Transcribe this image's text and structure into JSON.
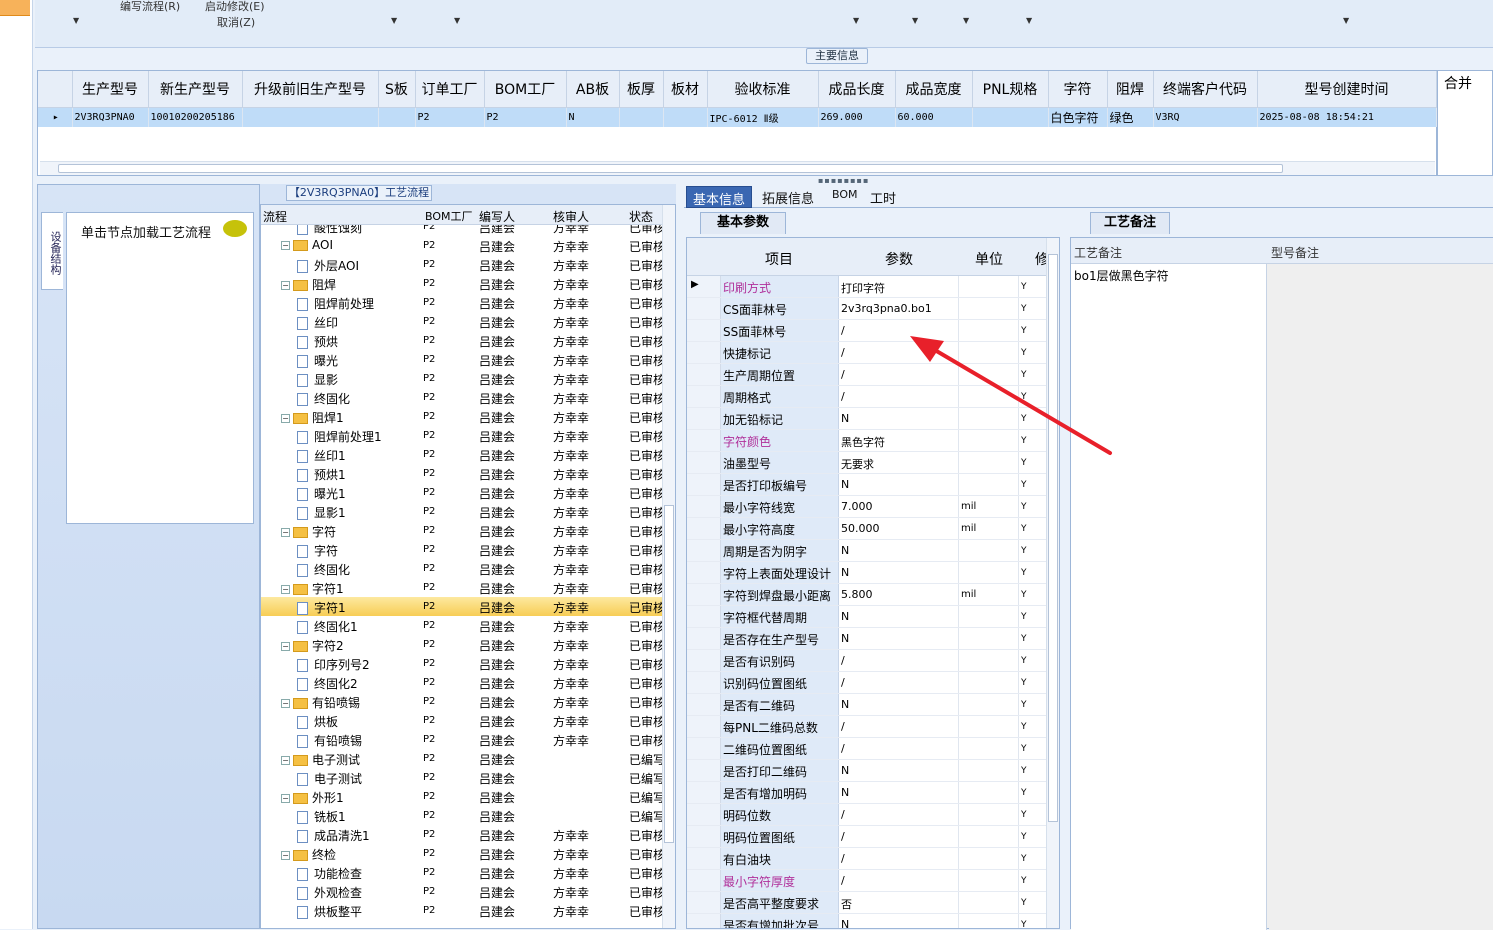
{
  "toolbar": {
    "items": [
      "编写流程(R)",
      "启动修改(E)",
      "取消(Z)"
    ]
  },
  "main_info": {
    "legend": "主要信息",
    "columns": [
      "生产型号",
      "新生产型号",
      "升级前旧生产型号",
      "S板",
      "订单工厂",
      "BOM工厂",
      "AB板",
      "板厚",
      "板材",
      "验收标准",
      "成品长度",
      "成品宽度",
      "PNL规格",
      "字符",
      "阻焊",
      "终端客户代码",
      "型号创建时间"
    ],
    "row": [
      "2V3RQ3PNA0",
      "10010200205186",
      "",
      "",
      "P2",
      "P2",
      "N",
      "",
      "",
      "IPC-6012 Ⅱ级",
      "269.000",
      "60.000",
      "",
      "白色字符",
      "绿色",
      "V3RQ",
      "2025-08-08 18:54:21"
    ],
    "right_col": "合并"
  },
  "left_panel": {
    "vtab": "设备结构",
    "load_text": "单击节点加载工艺流程"
  },
  "process": {
    "legend": "【2V3RQ3PNA0】工艺流程",
    "columns": [
      "流程",
      "BOM工厂",
      "编写人",
      "核审人",
      "状态"
    ],
    "rows": [
      {
        "name": "酸性蚀刻",
        "kind": "doc",
        "bom": "P2",
        "writer": "吕建会",
        "auditor": "方幸幸",
        "status": "已审核"
      },
      {
        "name": "AOI",
        "kind": "folder",
        "bom": "P2",
        "writer": "吕建会",
        "auditor": "方幸幸",
        "status": "已审核"
      },
      {
        "name": "外层AOI",
        "kind": "doc",
        "bom": "P2",
        "writer": "吕建会",
        "auditor": "方幸幸",
        "status": "已审核"
      },
      {
        "name": "阻焊",
        "kind": "folder",
        "bom": "P2",
        "writer": "吕建会",
        "auditor": "方幸幸",
        "status": "已审核"
      },
      {
        "name": "阻焊前处理",
        "kind": "doc",
        "bom": "P2",
        "writer": "吕建会",
        "auditor": "方幸幸",
        "status": "已审核"
      },
      {
        "name": "丝印",
        "kind": "doc",
        "bom": "P2",
        "writer": "吕建会",
        "auditor": "方幸幸",
        "status": "已审核"
      },
      {
        "name": "预烘",
        "kind": "doc",
        "bom": "P2",
        "writer": "吕建会",
        "auditor": "方幸幸",
        "status": "已审核"
      },
      {
        "name": "曝光",
        "kind": "doc",
        "bom": "P2",
        "writer": "吕建会",
        "auditor": "方幸幸",
        "status": "已审核"
      },
      {
        "name": "显影",
        "kind": "doc",
        "bom": "P2",
        "writer": "吕建会",
        "auditor": "方幸幸",
        "status": "已审核"
      },
      {
        "name": "终固化",
        "kind": "doc",
        "bom": "P2",
        "writer": "吕建会",
        "auditor": "方幸幸",
        "status": "已审核"
      },
      {
        "name": "阻焊1",
        "kind": "folder",
        "bom": "P2",
        "writer": "吕建会",
        "auditor": "方幸幸",
        "status": "已审核"
      },
      {
        "name": "阻焊前处理1",
        "kind": "doc",
        "bom": "P2",
        "writer": "吕建会",
        "auditor": "方幸幸",
        "status": "已审核"
      },
      {
        "name": "丝印1",
        "kind": "doc",
        "bom": "P2",
        "writer": "吕建会",
        "auditor": "方幸幸",
        "status": "已审核"
      },
      {
        "name": "预烘1",
        "kind": "doc",
        "bom": "P2",
        "writer": "吕建会",
        "auditor": "方幸幸",
        "status": "已审核"
      },
      {
        "name": "曝光1",
        "kind": "doc",
        "bom": "P2",
        "writer": "吕建会",
        "auditor": "方幸幸",
        "status": "已审核"
      },
      {
        "name": "显影1",
        "kind": "doc",
        "bom": "P2",
        "writer": "吕建会",
        "auditor": "方幸幸",
        "status": "已审核"
      },
      {
        "name": "字符",
        "kind": "folder",
        "bom": "P2",
        "writer": "吕建会",
        "auditor": "方幸幸",
        "status": "已审核"
      },
      {
        "name": "字符",
        "kind": "doc",
        "bom": "P2",
        "writer": "吕建会",
        "auditor": "方幸幸",
        "status": "已审核"
      },
      {
        "name": "终固化",
        "kind": "doc",
        "bom": "P2",
        "writer": "吕建会",
        "auditor": "方幸幸",
        "status": "已审核"
      },
      {
        "name": "字符1",
        "kind": "folder",
        "bom": "P2",
        "writer": "吕建会",
        "auditor": "方幸幸",
        "status": "已审核"
      },
      {
        "name": "字符1",
        "kind": "doc",
        "bom": "P2",
        "writer": "吕建会",
        "auditor": "方幸幸",
        "status": "已审核",
        "selected": true
      },
      {
        "name": "终固化1",
        "kind": "doc",
        "bom": "P2",
        "writer": "吕建会",
        "auditor": "方幸幸",
        "status": "已审核"
      },
      {
        "name": "字符2",
        "kind": "folder",
        "bom": "P2",
        "writer": "吕建会",
        "auditor": "方幸幸",
        "status": "已审核"
      },
      {
        "name": "印序列号2",
        "kind": "doc",
        "bom": "P2",
        "writer": "吕建会",
        "auditor": "方幸幸",
        "status": "已审核"
      },
      {
        "name": "终固化2",
        "kind": "doc",
        "bom": "P2",
        "writer": "吕建会",
        "auditor": "方幸幸",
        "status": "已审核"
      },
      {
        "name": "有铅喷锡",
        "kind": "folder",
        "bom": "P2",
        "writer": "吕建会",
        "auditor": "方幸幸",
        "status": "已审核"
      },
      {
        "name": "烘板",
        "kind": "doc",
        "bom": "P2",
        "writer": "吕建会",
        "auditor": "方幸幸",
        "status": "已审核"
      },
      {
        "name": "有铅喷锡",
        "kind": "doc",
        "bom": "P2",
        "writer": "吕建会",
        "auditor": "方幸幸",
        "status": "已审核"
      },
      {
        "name": "电子测试",
        "kind": "folder",
        "bom": "P2",
        "writer": "吕建会",
        "auditor": "",
        "status": "已编写"
      },
      {
        "name": "电子测试",
        "kind": "doc",
        "bom": "P2",
        "writer": "吕建会",
        "auditor": "",
        "status": "已编写"
      },
      {
        "name": "外形1",
        "kind": "folder",
        "bom": "P2",
        "writer": "吕建会",
        "auditor": "",
        "status": "已编写"
      },
      {
        "name": "铣板1",
        "kind": "doc",
        "bom": "P2",
        "writer": "吕建会",
        "auditor": "",
        "status": "已编写"
      },
      {
        "name": "成品清洗1",
        "kind": "doc",
        "bom": "P2",
        "writer": "吕建会",
        "auditor": "方幸幸",
        "status": "已审核"
      },
      {
        "name": "终检",
        "kind": "folder",
        "bom": "P2",
        "writer": "吕建会",
        "auditor": "方幸幸",
        "status": "已审核"
      },
      {
        "name": "功能检查",
        "kind": "doc",
        "bom": "P2",
        "writer": "吕建会",
        "auditor": "方幸幸",
        "status": "已审核"
      },
      {
        "name": "外观检查",
        "kind": "doc",
        "bom": "P2",
        "writer": "吕建会",
        "auditor": "方幸幸",
        "status": "已审核"
      },
      {
        "name": "烘板整平",
        "kind": "doc",
        "bom": "P2",
        "writer": "吕建会",
        "auditor": "方幸幸",
        "status": "已审核"
      }
    ]
  },
  "tabs": [
    "基本信息",
    "拓展信息",
    "BOM",
    "工时"
  ],
  "basic": {
    "subtab": "基本参数",
    "columns": [
      "项目",
      "参数",
      "单位",
      "修"
    ],
    "rows": [
      {
        "item": "印刷方式",
        "param": "打印字符",
        "unit": "",
        "mod": "Y",
        "pink": true,
        "current": true
      },
      {
        "item": "CS面菲林号",
        "param": "2v3rq3pna0.bo1",
        "unit": "",
        "mod": "Y"
      },
      {
        "item": "SS面菲林号",
        "param": "/",
        "unit": "",
        "mod": "Y"
      },
      {
        "item": "快捷标记",
        "param": "/",
        "unit": "",
        "mod": "Y"
      },
      {
        "item": "生产周期位置",
        "param": "/",
        "unit": "",
        "mod": "Y"
      },
      {
        "item": "周期格式",
        "param": "/",
        "unit": "",
        "mod": "Y"
      },
      {
        "item": "加无铅标记",
        "param": "N",
        "unit": "",
        "mod": "Y"
      },
      {
        "item": "字符颜色",
        "param": "黑色字符",
        "unit": "",
        "mod": "Y",
        "pink": true
      },
      {
        "item": "油墨型号",
        "param": "无要求",
        "unit": "",
        "mod": "Y"
      },
      {
        "item": "是否打印板编号",
        "param": "N",
        "unit": "",
        "mod": "Y"
      },
      {
        "item": "最小字符线宽",
        "param": "7.000",
        "unit": "mil",
        "mod": "Y"
      },
      {
        "item": "最小字符高度",
        "param": "50.000",
        "unit": "mil",
        "mod": "Y"
      },
      {
        "item": "周期是否为阴字",
        "param": "N",
        "unit": "",
        "mod": "Y"
      },
      {
        "item": "字符上表面处理设计",
        "param": "N",
        "unit": "",
        "mod": "Y"
      },
      {
        "item": "字符到焊盘最小距离",
        "param": "5.800",
        "unit": "mil",
        "mod": "Y"
      },
      {
        "item": "字符框代替周期",
        "param": "N",
        "unit": "",
        "mod": "Y"
      },
      {
        "item": "是否存在生产型号",
        "param": "N",
        "unit": "",
        "mod": "Y"
      },
      {
        "item": "是否有识别码",
        "param": "/",
        "unit": "",
        "mod": "Y"
      },
      {
        "item": "识别码位置图纸",
        "param": "/",
        "unit": "",
        "mod": "Y"
      },
      {
        "item": "是否有二维码",
        "param": "N",
        "unit": "",
        "mod": "Y"
      },
      {
        "item": "每PNL二维码总数",
        "param": "/",
        "unit": "",
        "mod": "Y"
      },
      {
        "item": "二维码位置图纸",
        "param": "/",
        "unit": "",
        "mod": "Y"
      },
      {
        "item": "是否打印二维码",
        "param": "N",
        "unit": "",
        "mod": "Y"
      },
      {
        "item": "是否有增加明码",
        "param": "N",
        "unit": "",
        "mod": "Y"
      },
      {
        "item": "明码位数",
        "param": "/",
        "unit": "",
        "mod": "Y"
      },
      {
        "item": "明码位置图纸",
        "param": "/",
        "unit": "",
        "mod": "Y"
      },
      {
        "item": "有白油块",
        "param": "/",
        "unit": "",
        "mod": "Y"
      },
      {
        "item": "最小字符厚度",
        "param": "/",
        "unit": "",
        "mod": "Y",
        "pink": true
      },
      {
        "item": "是否高平整度要求",
        "param": "否",
        "unit": "",
        "mod": "Y"
      },
      {
        "item": "是否有增加批次号",
        "param": "N",
        "unit": "",
        "mod": "Y"
      }
    ]
  },
  "notes": {
    "subtab": "工艺备注",
    "col1": "工艺备注",
    "col2": "型号备注",
    "text": "bo1层做黑色字符"
  },
  "colors": {
    "annotation_arrow": "#e8202a",
    "selected_row": "#bfdcf8",
    "tab_active": "#3a67b2"
  }
}
